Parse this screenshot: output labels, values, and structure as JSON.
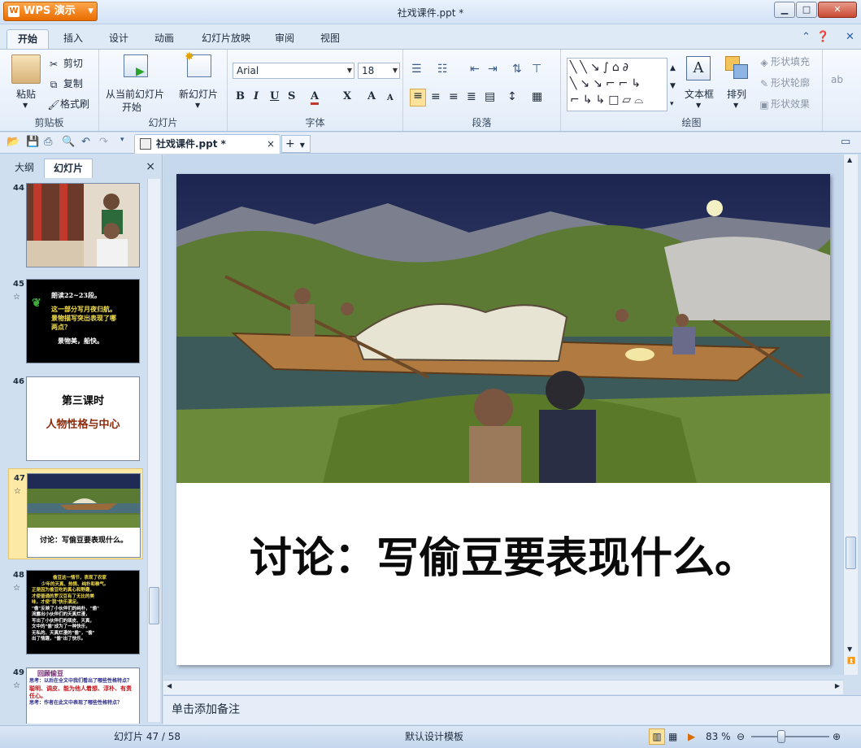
{
  "app": {
    "name": "WPS 演示",
    "window_title": "社戏课件.ppt *"
  },
  "menu": {
    "tabs": [
      "开始",
      "插入",
      "设计",
      "动画",
      "幻灯片放映",
      "审阅",
      "视图"
    ],
    "active_tab": "开始"
  },
  "ribbon": {
    "clipboard": {
      "paste": "粘贴",
      "cut": "剪切",
      "copy": "复制",
      "format_painter": "格式刷",
      "label": "剪贴板"
    },
    "slides": {
      "from_current": "从当前幻灯片",
      "start": "开始",
      "new_slide": "新幻灯片",
      "label": "幻灯片"
    },
    "font": {
      "name": "Arial",
      "size": "18",
      "bold": "B",
      "italic": "I",
      "underline": "U",
      "shadow": "S",
      "color": "A",
      "super_sub": "X",
      "grow": "A",
      "shrink": "A",
      "label": "字体"
    },
    "paragraph": {
      "label": "段落"
    },
    "drawing": {
      "text_box": "文本框",
      "arrange": "排列",
      "shape_fill": "形状填充",
      "shape_outline": "形状轮廓",
      "shape_effect": "形状效果",
      "label": "绘图"
    }
  },
  "toolbar": {
    "doc_tab": "社戏课件.ppt *",
    "close": "×",
    "new_tab": "+"
  },
  "left_panel": {
    "tabs": [
      "大纲",
      "幻灯片"
    ],
    "active_tab": "幻灯片",
    "close": "×",
    "thumbnails": [
      {
        "num": "44",
        "star": false
      },
      {
        "num": "45",
        "star": true,
        "lines": [
          "朗读22~23段。",
          "这一部分写月夜归航。",
          "景物描写突出表现了哪",
          "两点？",
          "景物美，船快。"
        ]
      },
      {
        "num": "46",
        "star": false,
        "lines": [
          "第三课时",
          "人物性格与中心"
        ]
      },
      {
        "num": "47",
        "star": true,
        "lines": [
          "讨论：写偷豆要表现什么。"
        ]
      },
      {
        "num": "48",
        "star": true,
        "lines": [
          "偷豆这一情节，表现了农家",
          "少年的天真、热情、纯朴和稚气。",
          "正是因为偷豆吃的真心和野趣，",
          "才使普通的罗汉豆有了无比的美",
          "味，才使\"我\"快乐满足。",
          "\"偷\"反映了小伙伴们的纯朴，\"偷\"",
          "流露出小伙伴们的天真烂漫，",
          "写出了小伙伴们的顽皮、天真，",
          "文中的\"偷\"成为了一种快乐，",
          "无私的、天真烂漫的\"偷\"，\"偷\"",
          "出了情趣，\"偷\"出了快乐。"
        ]
      },
      {
        "num": "49",
        "star": true,
        "lines": [
          "回顾偷豆",
          "思考：以后在全文中我们看出了哪些性格特点？",
          "聪明、调皮、能为他人着想、淳朴、有责任心。",
          "思考：作者在此文中表现了哪些性格特点？"
        ]
      }
    ]
  },
  "slide": {
    "text": "讨论：写偷豆要表现什么。"
  },
  "notes": {
    "placeholder": "单击添加备注"
  },
  "status": {
    "slide_counter": "幻灯片 47 / 58",
    "template": "默认设计模板",
    "zoom": "83 %"
  }
}
